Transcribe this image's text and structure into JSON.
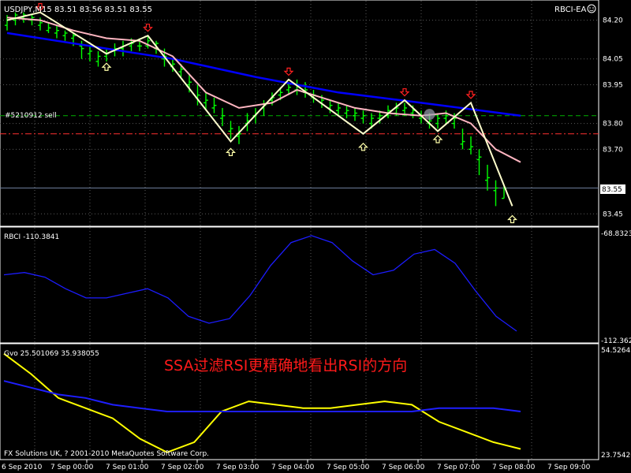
{
  "chart_window": {
    "symbol_label": "USDJPY,M15  83.51 83.56 83.51 83.55",
    "ea_label": "RBCI-EA",
    "order_label": "#5210912 sell",
    "current_price": "83.55",
    "watermark_text": "SSA过滤RSI更精确地看出RSI的方向",
    "copyright": "FX Solutions UK, ? 2001-2010 MetaQuotes Software Corp.",
    "colors": {
      "background": "#000000",
      "grid": "#5a5a5a",
      "bull_bar": "#00ff00",
      "zigzag": "#ffffcc",
      "smooth": "#ffb6c1",
      "ma": "#0000ff",
      "rbci": "#1c1cff",
      "gvo_fast": "#ffff00",
      "gvo_slow": "#1e1eff",
      "arrow_down": "#ff2020",
      "arrow_up": "#ffffaa",
      "order_line": "#00b000",
      "stop_line": "#ff3030",
      "watermark": "#ff1a1a"
    }
  },
  "chart_data": [
    {
      "type": "line",
      "title": "USDJPY,M15  83.51 83.56 83.51 83.55",
      "y_ticks": [
        "84.20",
        "84.05",
        "83.95",
        "83.80",
        "83.70",
        "83.55",
        "83.45"
      ],
      "x_ticks": [
        "6 Sep 2010",
        "7 Sep 00:00",
        "7 Sep 01:00",
        "7 Sep 02:00",
        "7 Sep 03:00",
        "7 Sep 04:00",
        "7 Sep 05:00",
        "7 Sep 06:00",
        "7 Sep 07:00",
        "7 Sep 08:00",
        "7 Sep 09:00"
      ],
      "ylim": [
        83.405,
        84.275
      ],
      "bars": [
        {
          "o": 84.18,
          "c": 84.21,
          "h": 84.22,
          "l": 84.16
        },
        {
          "o": 84.2,
          "c": 84.22,
          "h": 84.23,
          "l": 84.18
        },
        {
          "o": 84.21,
          "c": 84.22,
          "h": 84.23,
          "l": 84.19
        },
        {
          "o": 84.2,
          "c": 84.21,
          "h": 84.22,
          "l": 84.18
        },
        {
          "o": 84.18,
          "c": 84.19,
          "h": 84.21,
          "l": 84.16
        },
        {
          "o": 84.16,
          "c": 84.17,
          "h": 84.19,
          "l": 84.15
        },
        {
          "o": 84.15,
          "c": 84.16,
          "h": 84.18,
          "l": 84.13
        },
        {
          "o": 84.14,
          "c": 84.15,
          "h": 84.16,
          "l": 84.12
        },
        {
          "o": 84.13,
          "c": 84.14,
          "h": 84.15,
          "l": 84.1
        },
        {
          "o": 84.1,
          "c": 84.09,
          "h": 84.12,
          "l": 84.05
        },
        {
          "o": 84.07,
          "c": 84.08,
          "h": 84.1,
          "l": 84.04
        },
        {
          "o": 84.04,
          "c": 84.06,
          "h": 84.08,
          "l": 84.02
        },
        {
          "o": 84.06,
          "c": 84.07,
          "h": 84.09,
          "l": 84.04
        },
        {
          "o": 84.08,
          "c": 84.09,
          "h": 84.11,
          "l": 84.06
        },
        {
          "o": 84.09,
          "c": 84.1,
          "h": 84.12,
          "l": 84.06
        },
        {
          "o": 84.1,
          "c": 84.11,
          "h": 84.13,
          "l": 84.08
        },
        {
          "o": 84.1,
          "c": 84.1,
          "h": 84.13,
          "l": 84.08
        },
        {
          "o": 84.1,
          "c": 84.12,
          "h": 84.14,
          "l": 84.09
        },
        {
          "o": 84.09,
          "c": 84.11,
          "h": 84.12,
          "l": 84.07
        },
        {
          "o": 84.05,
          "c": 84.06,
          "h": 84.09,
          "l": 84.02
        },
        {
          "o": 84.02,
          "c": 84.03,
          "h": 84.05,
          "l": 84.0
        },
        {
          "o": 84.0,
          "c": 84.01,
          "h": 84.03,
          "l": 83.98
        },
        {
          "o": 83.95,
          "c": 83.96,
          "h": 83.99,
          "l": 83.92
        },
        {
          "o": 83.9,
          "c": 83.91,
          "h": 83.95,
          "l": 83.87
        },
        {
          "o": 83.88,
          "c": 83.89,
          "h": 83.92,
          "l": 83.85
        },
        {
          "o": 83.86,
          "c": 83.87,
          "h": 83.9,
          "l": 83.84
        },
        {
          "o": 83.82,
          "c": 83.83,
          "h": 83.86,
          "l": 83.79
        },
        {
          "o": 83.77,
          "c": 83.78,
          "h": 83.81,
          "l": 83.74
        },
        {
          "o": 83.75,
          "c": 83.76,
          "h": 83.79,
          "l": 83.72
        },
        {
          "o": 83.8,
          "c": 83.81,
          "h": 83.84,
          "l": 83.77
        },
        {
          "o": 83.83,
          "c": 83.84,
          "h": 83.86,
          "l": 83.8
        },
        {
          "o": 83.86,
          "c": 83.87,
          "h": 83.89,
          "l": 83.83
        },
        {
          "o": 83.89,
          "c": 83.9,
          "h": 83.92,
          "l": 83.87
        },
        {
          "o": 83.91,
          "c": 83.92,
          "h": 83.94,
          "l": 83.89
        },
        {
          "o": 83.93,
          "c": 83.94,
          "h": 83.96,
          "l": 83.91
        },
        {
          "o": 83.93,
          "c": 83.95,
          "h": 83.97,
          "l": 83.91
        },
        {
          "o": 83.92,
          "c": 83.93,
          "h": 83.96,
          "l": 83.9
        },
        {
          "o": 83.9,
          "c": 83.91,
          "h": 83.93,
          "l": 83.88
        },
        {
          "o": 83.88,
          "c": 83.89,
          "h": 83.91,
          "l": 83.86
        },
        {
          "o": 83.86,
          "c": 83.87,
          "h": 83.89,
          "l": 83.84
        },
        {
          "o": 83.85,
          "c": 83.86,
          "h": 83.88,
          "l": 83.83
        },
        {
          "o": 83.84,
          "c": 83.85,
          "h": 83.87,
          "l": 83.82
        },
        {
          "o": 83.83,
          "c": 83.84,
          "h": 83.86,
          "l": 83.81
        },
        {
          "o": 83.82,
          "c": 83.83,
          "h": 83.85,
          "l": 83.8
        },
        {
          "o": 83.8,
          "c": 83.82,
          "h": 83.84,
          "l": 83.78
        },
        {
          "o": 83.82,
          "c": 83.83,
          "h": 83.85,
          "l": 83.8
        },
        {
          "o": 83.83,
          "c": 83.85,
          "h": 83.87,
          "l": 83.82
        },
        {
          "o": 83.84,
          "c": 83.86,
          "h": 83.88,
          "l": 83.83
        },
        {
          "o": 83.85,
          "c": 83.86,
          "h": 83.88,
          "l": 83.83
        },
        {
          "o": 83.84,
          "c": 83.85,
          "h": 83.87,
          "l": 83.82
        },
        {
          "o": 83.82,
          "c": 83.83,
          "h": 83.85,
          "l": 83.8
        },
        {
          "o": 83.8,
          "c": 83.81,
          "h": 83.84,
          "l": 83.78
        },
        {
          "o": 83.8,
          "c": 83.82,
          "h": 83.84,
          "l": 83.78
        },
        {
          "o": 83.82,
          "c": 83.83,
          "h": 83.85,
          "l": 83.8
        },
        {
          "o": 83.8,
          "c": 83.82,
          "h": 83.84,
          "l": 83.78
        },
        {
          "o": 83.72,
          "c": 83.73,
          "h": 83.78,
          "l": 83.7
        },
        {
          "o": 83.7,
          "c": 83.71,
          "h": 83.75,
          "l": 83.68
        },
        {
          "o": 83.66,
          "c": 83.67,
          "h": 83.7,
          "l": 83.6
        },
        {
          "o": 83.58,
          "c": 83.59,
          "h": 83.64,
          "l": 83.54
        },
        {
          "o": 83.54,
          "c": 83.55,
          "h": 83.58,
          "l": 83.48
        },
        {
          "o": 83.51,
          "c": 83.55,
          "h": 83.56,
          "l": 83.51
        }
      ],
      "zigzag": [
        [
          0,
          84.2
        ],
        [
          4,
          84.23
        ],
        [
          12,
          84.07
        ],
        [
          17,
          84.14
        ],
        [
          27,
          83.73
        ],
        [
          34,
          83.97
        ],
        [
          43,
          83.76
        ],
        [
          48,
          83.89
        ],
        [
          52,
          83.77
        ],
        [
          56,
          83.88
        ],
        [
          61,
          83.48
        ]
      ],
      "smooth": [
        [
          0,
          84.21
        ],
        [
          4,
          84.2
        ],
        [
          8,
          84.16
        ],
        [
          12,
          84.13
        ],
        [
          16,
          84.12
        ],
        [
          20,
          84.06
        ],
        [
          24,
          83.92
        ],
        [
          28,
          83.86
        ],
        [
          32,
          83.88
        ],
        [
          35,
          83.93
        ],
        [
          38,
          83.9
        ],
        [
          42,
          83.86
        ],
        [
          46,
          83.84
        ],
        [
          50,
          83.83
        ],
        [
          53,
          83.84
        ],
        [
          56,
          83.8
        ],
        [
          59,
          83.7
        ],
        [
          62,
          83.65
        ]
      ],
      "moving_average": [
        [
          0,
          84.15
        ],
        [
          10,
          84.1
        ],
        [
          20,
          84.05
        ],
        [
          30,
          83.98
        ],
        [
          40,
          83.92
        ],
        [
          50,
          83.88
        ],
        [
          62,
          83.83
        ]
      ],
      "arrows_down": [
        [
          4,
          84.24
        ],
        [
          17,
          84.16
        ],
        [
          34,
          83.99
        ],
        [
          48,
          83.91
        ],
        [
          56,
          83.9
        ]
      ],
      "arrows_up": [
        [
          12,
          84.03
        ],
        [
          27,
          83.7
        ],
        [
          43,
          83.72
        ],
        [
          52,
          83.75
        ],
        [
          61,
          83.44
        ]
      ],
      "order_level": 83.83,
      "stop_level": 83.76,
      "last_price": 83.55
    },
    {
      "type": "line",
      "title": "RBCI -110.3841",
      "y_ticks": [
        "-68.8323",
        "-112.362"
      ],
      "ylim": [
        -115.2,
        -65.6
      ],
      "series": [
        {
          "values": [
            -86,
            -85,
            -87,
            -92,
            -96,
            -96,
            -94,
            -92,
            -96,
            -104,
            -107,
            -105,
            -95,
            -82,
            -72,
            -69,
            -72,
            -80,
            -86,
            -84,
            -77,
            -75,
            -81,
            -93,
            -104,
            -110.4
          ]
        }
      ]
    },
    {
      "type": "line",
      "title": "Gvo 25.501069 35.938055",
      "y_ticks": [
        "54.526437",
        "23.75426"
      ],
      "ylim": [
        22.1,
        55.7
      ],
      "series": [
        {
          "values": [
            53,
            47,
            40,
            37,
            34,
            28,
            24,
            27,
            36,
            39,
            38,
            37,
            37,
            38,
            39,
            38,
            33,
            30,
            27,
            25
          ]
        },
        {
          "values": [
            45,
            43,
            41,
            40,
            38,
            37,
            36,
            36,
            36,
            36,
            36,
            36,
            36,
            36,
            36,
            36,
            37,
            37,
            37,
            36
          ]
        }
      ]
    }
  ]
}
